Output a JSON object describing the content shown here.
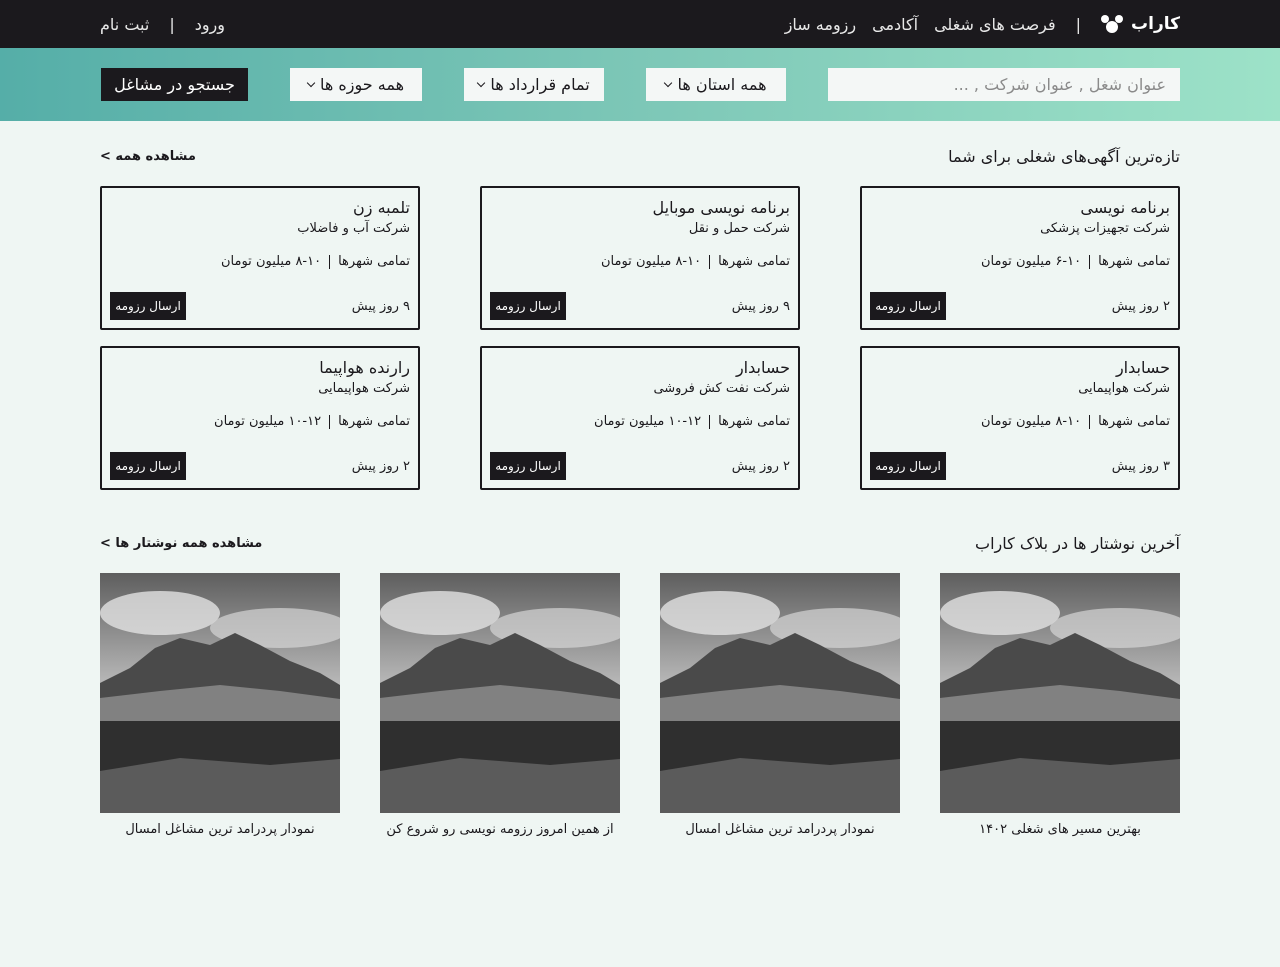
{
  "nav": {
    "brand": "کاراب",
    "links": [
      "فرصت های شغلی",
      "آکادمی",
      "رزومه ساز"
    ],
    "login": "ورود",
    "register": "ثبت نام",
    "separator": "|"
  },
  "search": {
    "placeholder": "عنوان شغل , عنوان شرکت , ...",
    "filters": [
      "همه استان ها",
      "تمام قرارداد ها",
      "همه حوزه ها"
    ],
    "button": "جستجو در مشاغل"
  },
  "jobs_section": {
    "title": "تازه‌ترین آگهی‌های شغلی برای شما",
    "see_all": "مشاهده همه >",
    "items": [
      {
        "title": "برنامه نویسی",
        "company": "شرکت تجهیزات پزشکی",
        "location": "تمامی شهرها",
        "salary": "۶-۱۰ میلیون تومان",
        "age": "۲ روز پیش",
        "apply": "ارسال رزومه"
      },
      {
        "title": "برنامه نویسی موبایل",
        "company": "شرکت حمل و نقل",
        "location": "تمامی شهرها",
        "salary": "۸-۱۰ میلیون تومان",
        "age": "۹ روز پیش",
        "apply": "ارسال رزومه"
      },
      {
        "title": "تلمبه زن",
        "company": "شرکت آب و فاضلاب",
        "location": "تمامی شهرها",
        "salary": "۸-۱۰ میلیون تومان",
        "age": "۹ روز پیش",
        "apply": "ارسال رزومه"
      },
      {
        "title": "حسابدار",
        "company": "شرکت هواپیمایی",
        "location": "تمامی شهرها",
        "salary": "۸-۱۰ میلیون تومان",
        "age": "۳ روز پیش",
        "apply": "ارسال رزومه"
      },
      {
        "title": "حسابدار",
        "company": "شرکت نفت کش فروشی",
        "location": "تمامی شهرها",
        "salary": "۱۰-۱۲ میلیون تومان",
        "age": "۲ روز پیش",
        "apply": "ارسال رزومه"
      },
      {
        "title": "رارنده هواپیما",
        "company": "شرکت هواپیمایی",
        "location": "تمامی شهرها",
        "salary": "۱۰-۱۲ میلیون تومان",
        "age": "۲ روز پیش",
        "apply": "ارسال رزومه"
      }
    ]
  },
  "blog_section": {
    "title": "آخرین نوشتار ها در بلاک کاراب",
    "see_all": "مشاهده همه نوشتار ها >",
    "items": [
      {
        "caption": "بهترین مسیر های شغلی ۱۴۰۲"
      },
      {
        "caption": "نمودار پردرامد ترین مشاغل امسال"
      },
      {
        "caption": "از همین امروز رزومه نویسی رو شروع کن"
      },
      {
        "caption": "نمودار پردرامد ترین مشاغل امسال"
      }
    ]
  }
}
